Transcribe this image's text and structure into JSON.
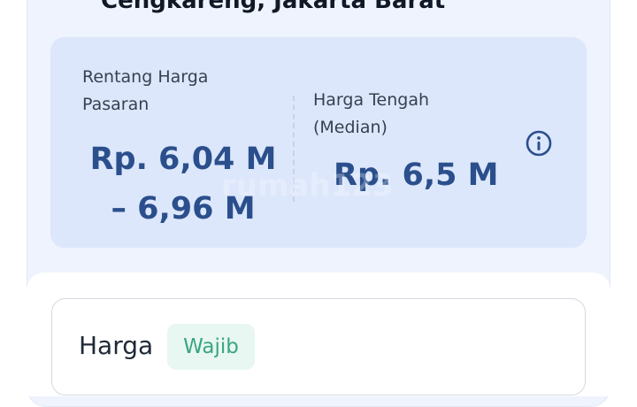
{
  "header": {
    "location_title": "Cengkareng, Jakarta Barat"
  },
  "price_estimate": {
    "range_label": "Rentang Harga Pasaran",
    "range_value": "Rp. 6,04 M – 6,96 M",
    "median_label": "Harga Tengah (Median)",
    "median_value": "Rp. 6,5 M",
    "info_icon": "info-circle-icon"
  },
  "form": {
    "price_field_label": "Harga",
    "required_badge": "Wajib"
  },
  "watermark": {
    "text": "rumah123"
  },
  "colors": {
    "panel_background": "#eef3fd",
    "card_background": "#dce7fb",
    "price_text": "#2b4f8c",
    "badge_background": "#e8f7f1",
    "badge_text": "#3aa583"
  }
}
